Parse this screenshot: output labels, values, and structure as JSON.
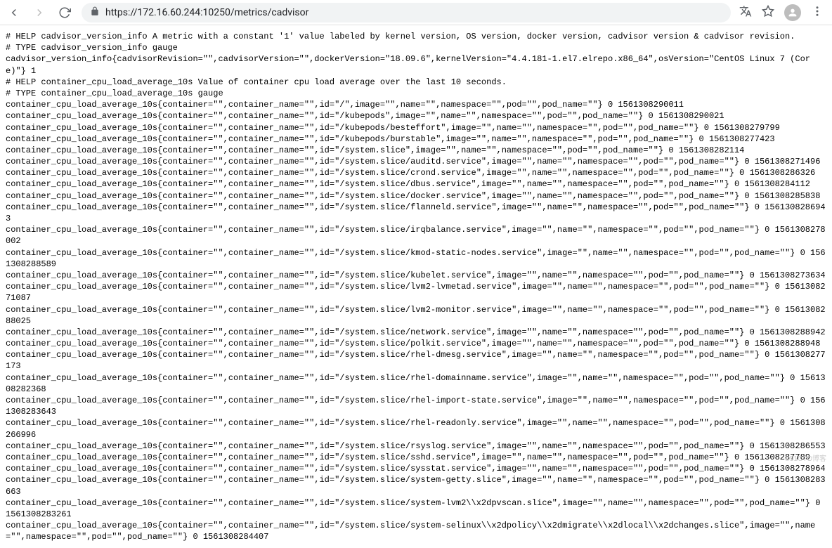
{
  "url": "https://172.16.60.244:10250/metrics/cadvisor",
  "watermark": "©51CTO博客",
  "lines": [
    "# HELP cadvisor_version_info A metric with a constant '1' value labeled by kernel version, OS version, docker version, cadvisor version & cadvisor revision.",
    "# TYPE cadvisor_version_info gauge",
    "cadvisor_version_info{cadvisorRevision=\"\",cadvisorVersion=\"\",dockerVersion=\"18.09.6\",kernelVersion=\"4.4.181-1.el7.elrepo.x86_64\",osVersion=\"CentOS Linux 7 (Core)\"} 1",
    "# HELP container_cpu_load_average_10s Value of container cpu load average over the last 10 seconds.",
    "# TYPE container_cpu_load_average_10s gauge",
    "container_cpu_load_average_10s{container=\"\",container_name=\"\",id=\"/\",image=\"\",name=\"\",namespace=\"\",pod=\"\",pod_name=\"\"} 0 1561308290011",
    "container_cpu_load_average_10s{container=\"\",container_name=\"\",id=\"/kubepods\",image=\"\",name=\"\",namespace=\"\",pod=\"\",pod_name=\"\"} 0 1561308290021",
    "container_cpu_load_average_10s{container=\"\",container_name=\"\",id=\"/kubepods/besteffort\",image=\"\",name=\"\",namespace=\"\",pod=\"\",pod_name=\"\"} 0 1561308279799",
    "container_cpu_load_average_10s{container=\"\",container_name=\"\",id=\"/kubepods/burstable\",image=\"\",name=\"\",namespace=\"\",pod=\"\",pod_name=\"\"} 0 1561308277423",
    "container_cpu_load_average_10s{container=\"\",container_name=\"\",id=\"/system.slice\",image=\"\",name=\"\",namespace=\"\",pod=\"\",pod_name=\"\"} 0 1561308282114",
    "container_cpu_load_average_10s{container=\"\",container_name=\"\",id=\"/system.slice/auditd.service\",image=\"\",name=\"\",namespace=\"\",pod=\"\",pod_name=\"\"} 0 1561308271496",
    "container_cpu_load_average_10s{container=\"\",container_name=\"\",id=\"/system.slice/crond.service\",image=\"\",name=\"\",namespace=\"\",pod=\"\",pod_name=\"\"} 0 1561308286326",
    "container_cpu_load_average_10s{container=\"\",container_name=\"\",id=\"/system.slice/dbus.service\",image=\"\",name=\"\",namespace=\"\",pod=\"\",pod_name=\"\"} 0 1561308284112",
    "container_cpu_load_average_10s{container=\"\",container_name=\"\",id=\"/system.slice/docker.service\",image=\"\",name=\"\",namespace=\"\",pod=\"\",pod_name=\"\"} 0 1561308285838",
    "container_cpu_load_average_10s{container=\"\",container_name=\"\",id=\"/system.slice/flanneld.service\",image=\"\",name=\"\",namespace=\"\",pod=\"\",pod_name=\"\"} 0 1561308286943",
    "container_cpu_load_average_10s{container=\"\",container_name=\"\",id=\"/system.slice/irqbalance.service\",image=\"\",name=\"\",namespace=\"\",pod=\"\",pod_name=\"\"} 0 1561308278002",
    "container_cpu_load_average_10s{container=\"\",container_name=\"\",id=\"/system.slice/kmod-static-nodes.service\",image=\"\",name=\"\",namespace=\"\",pod=\"\",pod_name=\"\"} 0 1561308288589",
    "container_cpu_load_average_10s{container=\"\",container_name=\"\",id=\"/system.slice/kubelet.service\",image=\"\",name=\"\",namespace=\"\",pod=\"\",pod_name=\"\"} 0 1561308273634",
    "container_cpu_load_average_10s{container=\"\",container_name=\"\",id=\"/system.slice/lvm2-lvmetad.service\",image=\"\",name=\"\",namespace=\"\",pod=\"\",pod_name=\"\"} 0 1561308271087",
    "container_cpu_load_average_10s{container=\"\",container_name=\"\",id=\"/system.slice/lvm2-monitor.service\",image=\"\",name=\"\",namespace=\"\",pod=\"\",pod_name=\"\"} 0 1561308288025",
    "container_cpu_load_average_10s{container=\"\",container_name=\"\",id=\"/system.slice/network.service\",image=\"\",name=\"\",namespace=\"\",pod=\"\",pod_name=\"\"} 0 1561308288942",
    "container_cpu_load_average_10s{container=\"\",container_name=\"\",id=\"/system.slice/polkit.service\",image=\"\",name=\"\",namespace=\"\",pod=\"\",pod_name=\"\"} 0 1561308288948",
    "container_cpu_load_average_10s{container=\"\",container_name=\"\",id=\"/system.slice/rhel-dmesg.service\",image=\"\",name=\"\",namespace=\"\",pod=\"\",pod_name=\"\"} 0 1561308277173",
    "container_cpu_load_average_10s{container=\"\",container_name=\"\",id=\"/system.slice/rhel-domainname.service\",image=\"\",name=\"\",namespace=\"\",pod=\"\",pod_name=\"\"} 0 1561308282368",
    "container_cpu_load_average_10s{container=\"\",container_name=\"\",id=\"/system.slice/rhel-import-state.service\",image=\"\",name=\"\",namespace=\"\",pod=\"\",pod_name=\"\"} 0 1561308283643",
    "container_cpu_load_average_10s{container=\"\",container_name=\"\",id=\"/system.slice/rhel-readonly.service\",image=\"\",name=\"\",namespace=\"\",pod=\"\",pod_name=\"\"} 0 1561308266996",
    "container_cpu_load_average_10s{container=\"\",container_name=\"\",id=\"/system.slice/rsyslog.service\",image=\"\",name=\"\",namespace=\"\",pod=\"\",pod_name=\"\"} 0 1561308286553",
    "container_cpu_load_average_10s{container=\"\",container_name=\"\",id=\"/system.slice/sshd.service\",image=\"\",name=\"\",namespace=\"\",pod=\"\",pod_name=\"\"} 0 1561308287789",
    "container_cpu_load_average_10s{container=\"\",container_name=\"\",id=\"/system.slice/sysstat.service\",image=\"\",name=\"\",namespace=\"\",pod=\"\",pod_name=\"\"} 0 1561308278964",
    "container_cpu_load_average_10s{container=\"\",container_name=\"\",id=\"/system.slice/system-getty.slice\",image=\"\",name=\"\",namespace=\"\",pod=\"\",pod_name=\"\"} 0 1561308283663",
    "container_cpu_load_average_10s{container=\"\",container_name=\"\",id=\"/system.slice/system-lvm2\\\\x2dpvscan.slice\",image=\"\",name=\"\",namespace=\"\",pod=\"\",pod_name=\"\"} 0 1561308283261",
    "container_cpu_load_average_10s{container=\"\",container_name=\"\",id=\"/system.slice/system-selinux\\\\x2dpolicy\\\\x2dmigrate\\\\x2dlocal\\\\x2dchanges.slice\",image=\"\",name=\"\",namespace=\"\",pod=\"\",pod_name=\"\"} 0 1561308284407"
  ]
}
